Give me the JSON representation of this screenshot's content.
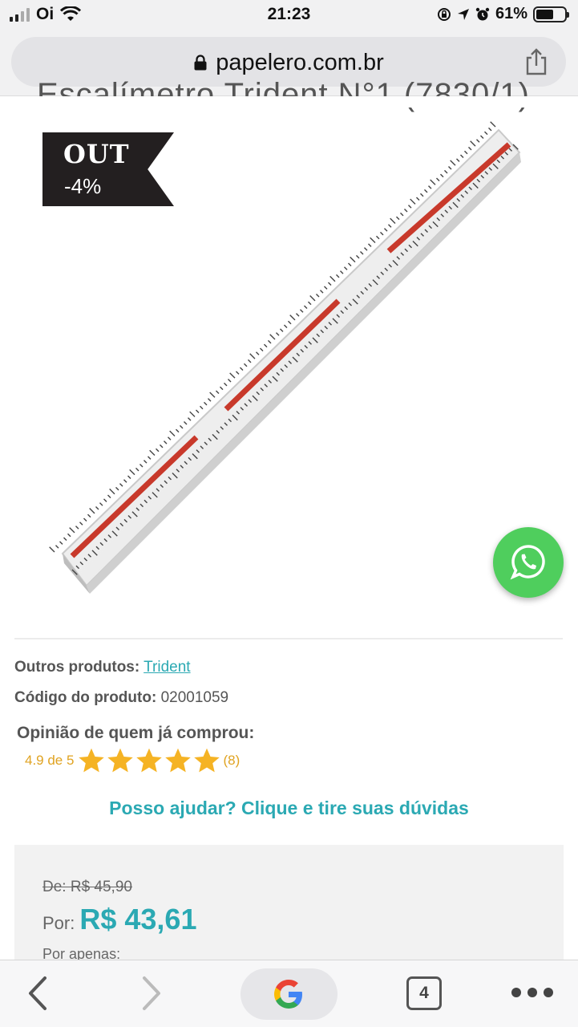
{
  "status_bar": {
    "carrier": "Oi",
    "time": "21:23",
    "battery": "61%",
    "battery_level": 0.61,
    "icons": [
      "signal-icon",
      "wifi-icon",
      "screen-lock-icon",
      "location-icon",
      "alarm-icon",
      "battery-icon"
    ]
  },
  "browser": {
    "url": "papelero.com.br",
    "tab_count": "4"
  },
  "product": {
    "title_partial": "Escalímetro Trident N°1 (7830/1)",
    "badge_out": "OUT",
    "badge_discount": "-4%",
    "image_icon": "triangular-scale-ruler",
    "other_products_label": "Outros produtos:",
    "other_products_link": "Trident",
    "code_label": "Código do produto:",
    "code_value": "02001059",
    "opinion_label": "Opinião de quem já comprou:",
    "rating_text": "4.9 de 5",
    "rating_value": 4.9,
    "rating_max": 5,
    "review_count": "(8)",
    "help_text": "Posso ajudar? Clique e tire suas dúvidas"
  },
  "price": {
    "old_price": "De: R$ 45,90",
    "por_label": "Por:",
    "current_price": "R$ 43,61",
    "por_apenas": "Por apenas:"
  },
  "colors": {
    "accent": "#2ba9b3",
    "star": "#f5b324",
    "whatsapp": "#4fce5d",
    "badge": "#231f20"
  }
}
